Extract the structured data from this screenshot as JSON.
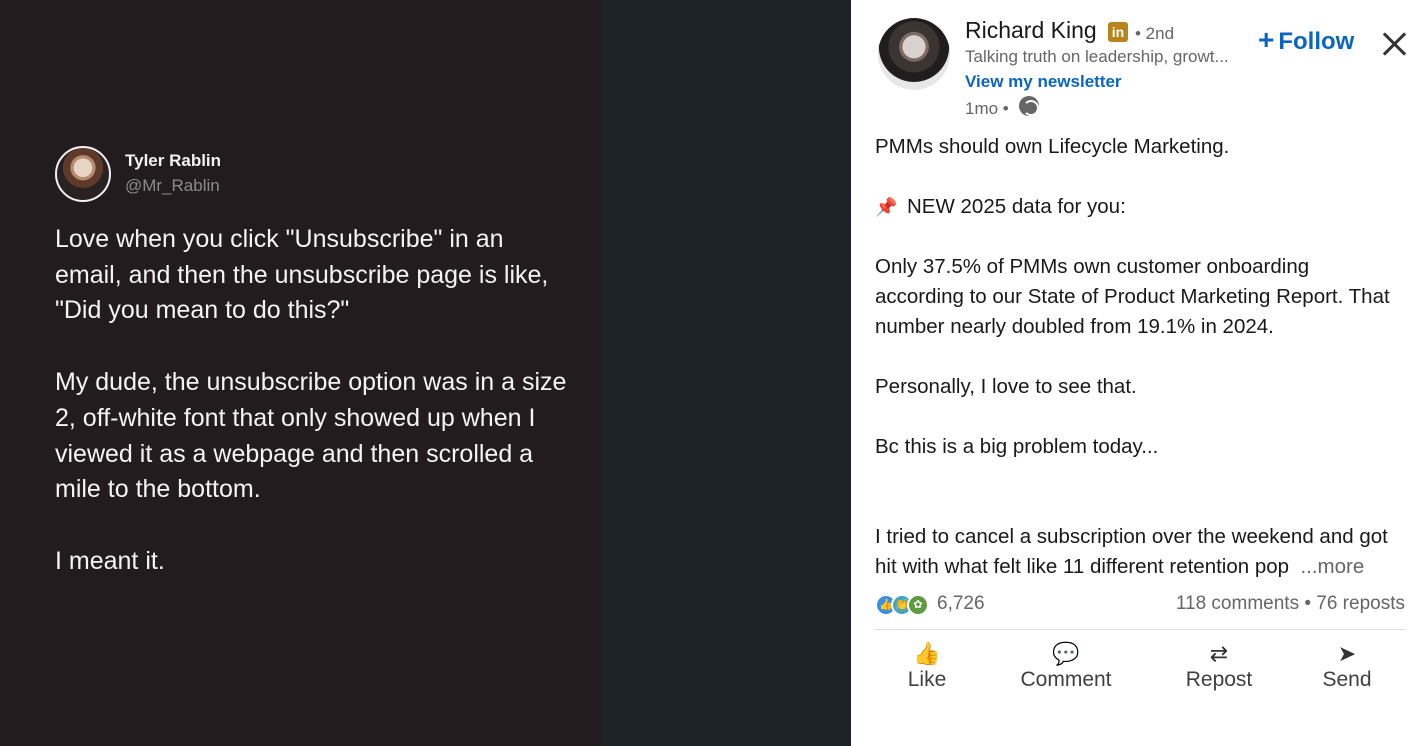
{
  "tweet": {
    "author_name": "Tyler Rablin",
    "author_handle": "@Mr_Rablin",
    "paragraphs": [
      "Love when you click \"Unsubscribe\" in an email, and then the unsubscribe page is like, \"Did you mean to do this?\"",
      "My dude, the unsubscribe option was in a size 2, off-white font that only showed up when I viewed it as a webpage and then scrolled a mile to the bottom.",
      "I meant it."
    ]
  },
  "post": {
    "author_name": "Richard King",
    "linkedin_badge": "in",
    "degree": "• 2nd",
    "headline": "Talking truth on leadership, growt...",
    "newsletter_link": "View my newsletter",
    "timestamp": "1mo •",
    "follow_label": "Follow",
    "body_lines": [
      "PMMs should own Lifecycle Marketing.",
      "",
      "NEW 2025 data for you:",
      "",
      "Only 37.5% of PMMs own customer onboarding",
      "according to our State of Product Marketing Report. That",
      "number nearly doubled from 19.1% in 2024.",
      "",
      "Personally, I love to see that.",
      "",
      "Bc this is a big problem today...",
      "",
      "",
      "I tried to cancel a subscription over the weekend and got",
      "hit with what felt like 11 different retention pop"
    ],
    "more_label": "...more",
    "reaction_count": "6,726",
    "comments_reposts": "118 comments • 76 reposts",
    "actions": {
      "like": "Like",
      "comment": "Comment",
      "repost": "Repost",
      "send": "Send"
    }
  },
  "colors": {
    "accent": "#0a66c2",
    "tweet_bg": "#231c1f",
    "media_bg": "#1d2226",
    "badge": "#b98419"
  },
  "icons": [
    "close-icon",
    "globe-icon",
    "pin-icon",
    "like-icon",
    "comment-icon",
    "repost-icon",
    "send-icon"
  ]
}
